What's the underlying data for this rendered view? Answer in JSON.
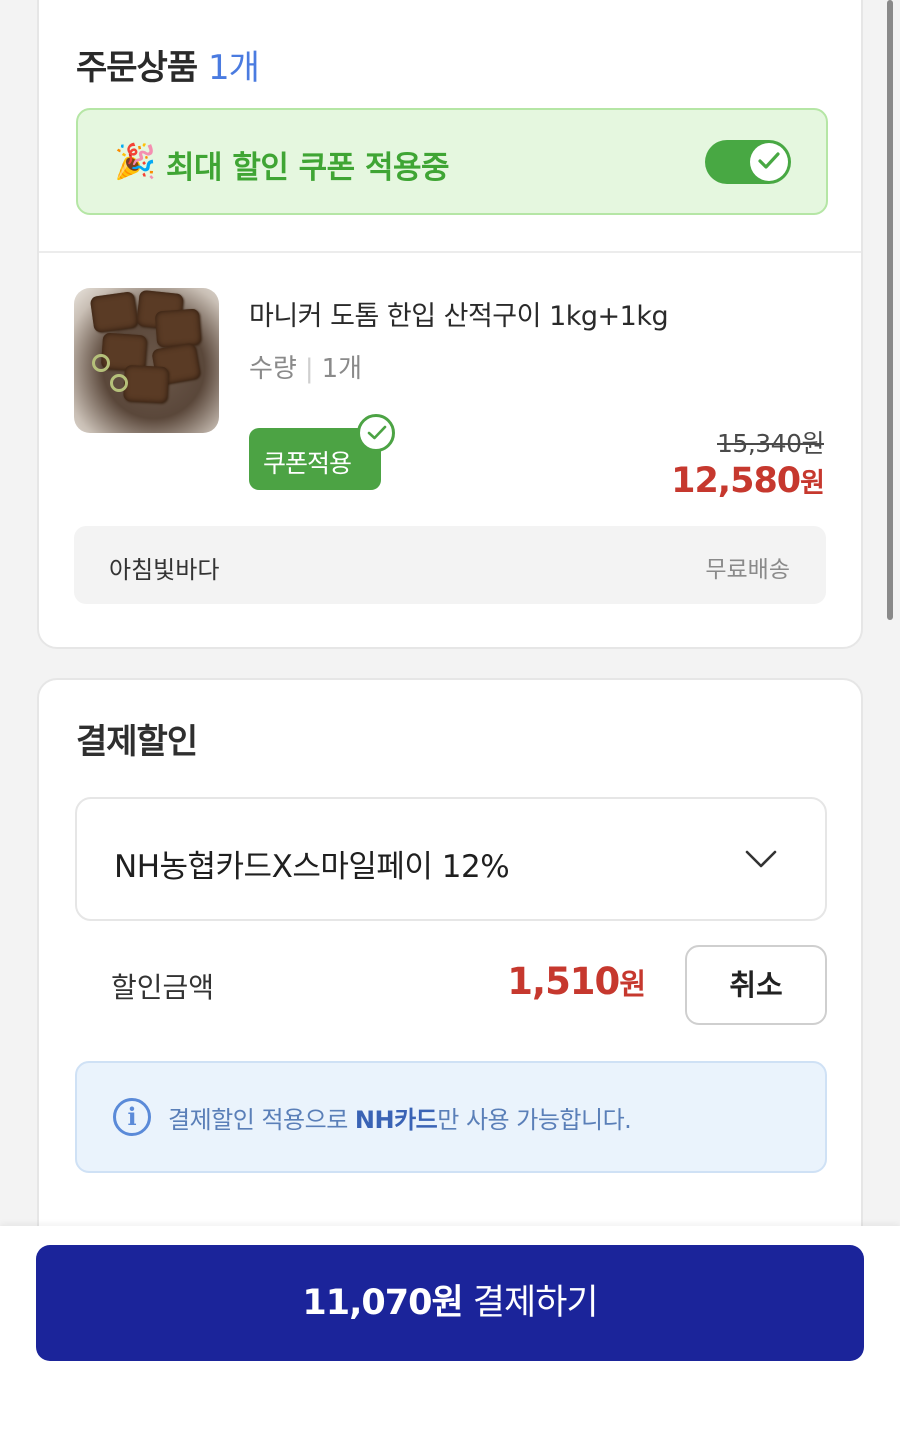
{
  "order_section": {
    "title": "주문상품",
    "count": "1개",
    "coupon_banner": {
      "emoji": "🎉",
      "text": "최대 할인 쿠폰 적용중",
      "toggle_on": true
    },
    "product": {
      "name": "마니커 도톰 한입 산적구이 1kg+1kg",
      "qty_label": "수량",
      "qty_value": "1개",
      "coupon_chip": "쿠폰적용",
      "original_price": "15,340원",
      "sale_price_number": "12,580",
      "sale_price_unit": "원"
    },
    "seller": {
      "name": "아침빛바다",
      "shipping": "무료배송"
    }
  },
  "payment_discount": {
    "title": "결제할인",
    "selected_option": "NH농협카드X스마일페이 12%",
    "discount_label": "할인금액",
    "discount_amount_number": "1,510",
    "discount_amount_unit": "원",
    "cancel_label": "취소",
    "info_prefix": "결제할인 적용으로 ",
    "info_bold": "NH카드",
    "info_suffix": "만 사용 가능합니다."
  },
  "checkout": {
    "amount": "11,070원",
    "label": "결제하기"
  },
  "colors": {
    "brand_blue": "#1b249a",
    "coupon_green": "#4ca344",
    "price_red": "#c6382e",
    "count_blue": "#4a7be0"
  }
}
